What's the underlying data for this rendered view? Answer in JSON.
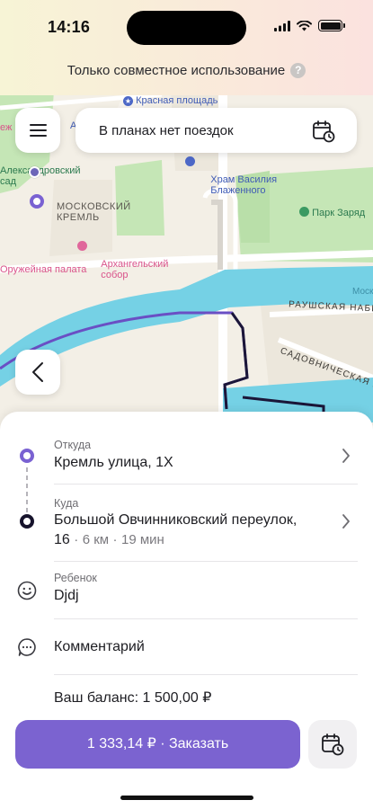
{
  "status_bar": {
    "time": "14:16"
  },
  "header": {
    "sharing_label": "Только совместное использование",
    "help_symbol": "?"
  },
  "top_controls": {
    "menu_icon": "hamburger-icon",
    "trips_label": "В планах нет поездок",
    "calendar_icon": "calendar-clock-icon"
  },
  "map": {
    "labels": {
      "red_square": "Красная площадь",
      "cut_left_e": "еж",
      "cut_left_a": "А",
      "basil": "Храм Василия\nБлаженного",
      "alexander_garden": "Александровский\nсад",
      "kremlin": "МОСКОВСКИЙ\nКРЕМЛЬ",
      "archangel": "Архангельский\nсобор",
      "armoury": "Оружейная палата",
      "park": "Парк Заряд",
      "raushskaya": "РАУШСКАЯ НАБЕ",
      "mosk": "Моск",
      "sadovnicheskaya": "САДОВНИЧЕСКАЯ УЛ"
    },
    "colors": {
      "water": "#73d1e6",
      "park": "#bfe3b0",
      "route_purple": "#6a4fc4",
      "route_dark": "#1b1638"
    }
  },
  "sheet": {
    "from": {
      "label": "Откуда",
      "value": "Кремль улица, 1Х"
    },
    "to": {
      "label": "Куда",
      "value_line1": "Большой Овчинниковский переулок,",
      "value_line2_addr": "16",
      "distance": "6  км",
      "duration": "19 мин",
      "separator": "·"
    },
    "child": {
      "label": "Ребенок",
      "value": "Djdj"
    },
    "comment": {
      "label": "Комментарий"
    },
    "balance": "Ваш баланс: 1 500,00 ₽"
  },
  "order_button": {
    "label": "1 333,14 ₽ · Заказать"
  },
  "colors": {
    "accent": "#7b63d0"
  }
}
